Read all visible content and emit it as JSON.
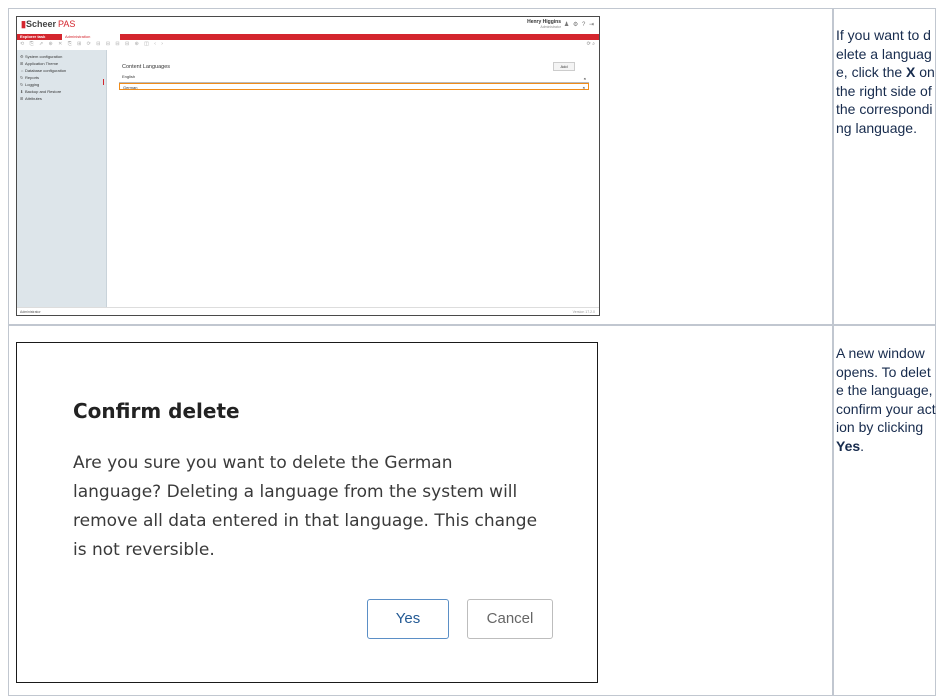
{
  "step1": {
    "description_parts": [
      "If you want to delete a language, click the ",
      "X",
      " on the right side of the corresponding language."
    ],
    "app": {
      "logo_brand": "Scheer",
      "logo_suffix": "PAS",
      "user_name": "Henry Higgins",
      "user_role": "Administrator",
      "header_icons": "♟ ⚙ ? ⇥",
      "tabs": {
        "explorer": "Explorer task",
        "admin": "Administration",
        "close": "×"
      },
      "toolbar_icons": "⟲ ⎘ ⇗ ⊕ ✕ ⎘ ⊞ ⟳ ⊟ ⊟ ⊟ ⊟ ⊕ ◫ ‹ ›",
      "toolbar_right": "⟳ ⌕",
      "sidebar": [
        {
          "icon": "⚙",
          "label": "System configuration"
        },
        {
          "icon": "⊞",
          "label": "Application Theme"
        },
        {
          "icon": "⇔",
          "label": "Database configuration"
        },
        {
          "icon": "↻",
          "label": "Reports"
        },
        {
          "icon": "↻",
          "label": "Logging"
        },
        {
          "icon": "⬇",
          "label": "Backup and Restore"
        },
        {
          "icon": "⊞",
          "label": "Attributes"
        }
      ],
      "main_title": "Content Languages",
      "add_label": "Add",
      "languages": [
        {
          "name": "English",
          "delete": "×"
        },
        {
          "name": "German",
          "delete": "×"
        }
      ],
      "footer_left": "Administrator",
      "footer_right": "Version 17.2.0"
    }
  },
  "step2": {
    "description_parts": [
      "A new window opens. To delete the language, confirm your action by clicking ",
      "Yes",
      "."
    ],
    "dialog": {
      "title": "Confirm delete",
      "message": "Are you sure you want to delete the German language? Deleting a language from the system will remove all data entered in that language. This change is not reversible.",
      "yes_label": "Yes",
      "cancel_label": "Cancel"
    }
  },
  "colors": {
    "brand_red": "#d4262e",
    "highlight_orange": "#f08c1a",
    "yes_blue": "#5b8fc6",
    "sidebar_bg": "#dde5ea"
  }
}
